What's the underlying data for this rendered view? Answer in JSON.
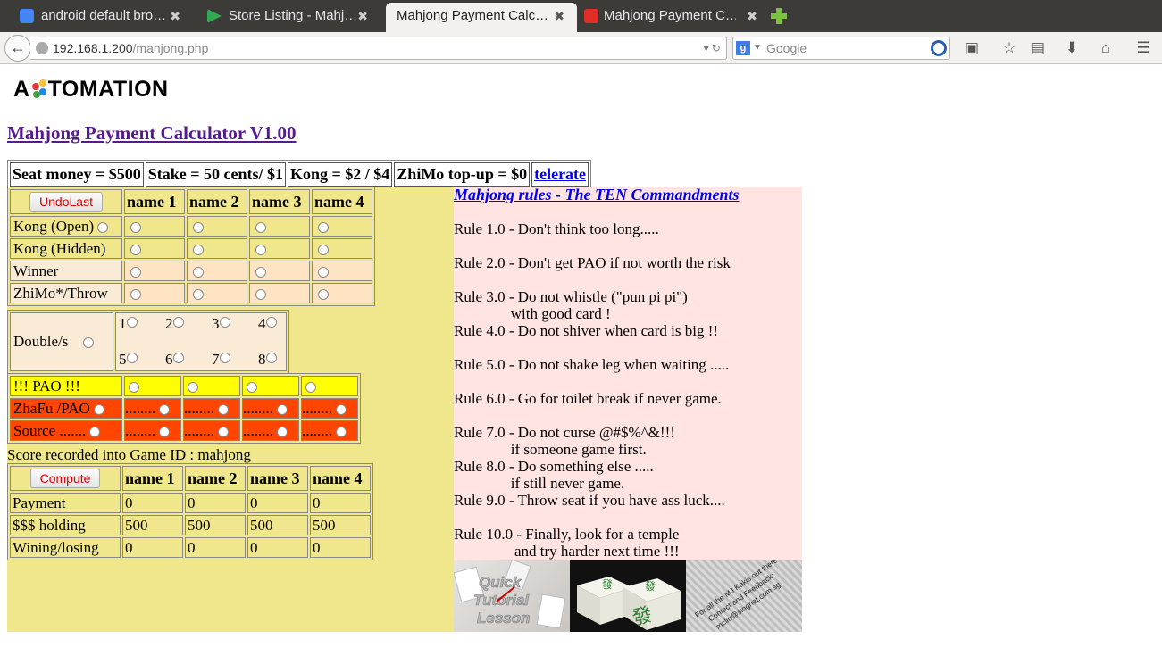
{
  "browser": {
    "tabs": [
      {
        "title": "android default bro…",
        "favicon": "google-icon",
        "color": "#4285f4"
      },
      {
        "title": "Store Listing - Mahj…",
        "favicon": "play-store-icon",
        "color": "#34a853"
      },
      {
        "title": "Mahjong Payment Calc…",
        "favicon": "",
        "color": ""
      },
      {
        "title": "Mahjong Payment C…",
        "favicon": "youtube-icon",
        "color": "#e52d27"
      }
    ],
    "close_glyph": "✖",
    "url_host": "192.168.1.200",
    "url_path": "/mahjong.php",
    "search_placeholder": "Google",
    "search_engine_letter": "g"
  },
  "page": {
    "logo_left": "A",
    "logo_right": "TOMATION",
    "logo_colors": [
      "#e53935",
      "#fbc02d",
      "#1e88e5",
      "#43a047"
    ],
    "title": "Mahjong Payment Calculator V1.00",
    "header": {
      "seat": "Seat money = $500",
      "stake": "Stake = 50 cents/ $1",
      "kong": "Kong = $2 / $4",
      "zhimo": "ZhiMo top-up = $0",
      "link": "telerate"
    },
    "players": [
      "name 1",
      "name 2",
      "name 3",
      "name 4"
    ],
    "undo_label": "UndoLast",
    "rows": {
      "kong_open": "Kong (Open)",
      "kong_hidden": "Kong (Hidden)",
      "winner": "Winner",
      "zhimo": "ZhiMo*/Throw"
    },
    "doubles": {
      "label": "Double/s",
      "values": [
        "1",
        "2",
        "3",
        "4",
        "5",
        "6",
        "7",
        "8"
      ]
    },
    "pao": {
      "label": "!!! PAO !!!",
      "zhafu": "ZhaFu /PAO",
      "source": "Source .......",
      "dots": "........"
    },
    "score_line": "Score recorded into Game ID : mahjong",
    "compute_label": "Compute",
    "results": {
      "payment_label": "Payment",
      "payment": [
        "0",
        "0",
        "0",
        "0"
      ],
      "holding_label": "$$$ holding",
      "holding": [
        "500",
        "500",
        "500",
        "500"
      ],
      "winning_label": "Wining/losing",
      "winning": [
        "0",
        "0",
        "0",
        "0"
      ]
    },
    "rules_title": "Mahjong rules - The TEN Commandments",
    "rules": [
      "Rule 1.0 - Don't think too long.....",
      "",
      "Rule 2.0 - Don't get PAO if not worth the risk",
      "",
      "Rule 3.0 - Do not whistle (\"pun pi pi\")",
      "               with good card !",
      "Rule 4.0 - Do not shiver when card is big !!",
      "",
      "Rule 5.0 - Do not shake leg when waiting .....",
      "",
      "Rule 6.0 - Go for toilet break if never game.",
      "",
      "Rule 7.0 - Do not curse @#$%^&!!!",
      "               if someone game first.",
      "Rule 8.0 - Do something else .....",
      "               if still never game.",
      "Rule 9.0 - Throw seat if you have ass luck....",
      "",
      "Rule 10.0 - Finally, look for a temple",
      "                and try harder next time !!!"
    ],
    "image_captions": {
      "tutorial": "Quick Tutorial Lesson",
      "tile": "發",
      "contact": "For all the MJ Kakis out there Contact and Feedback: mcliu@singnet.com.sg"
    }
  }
}
